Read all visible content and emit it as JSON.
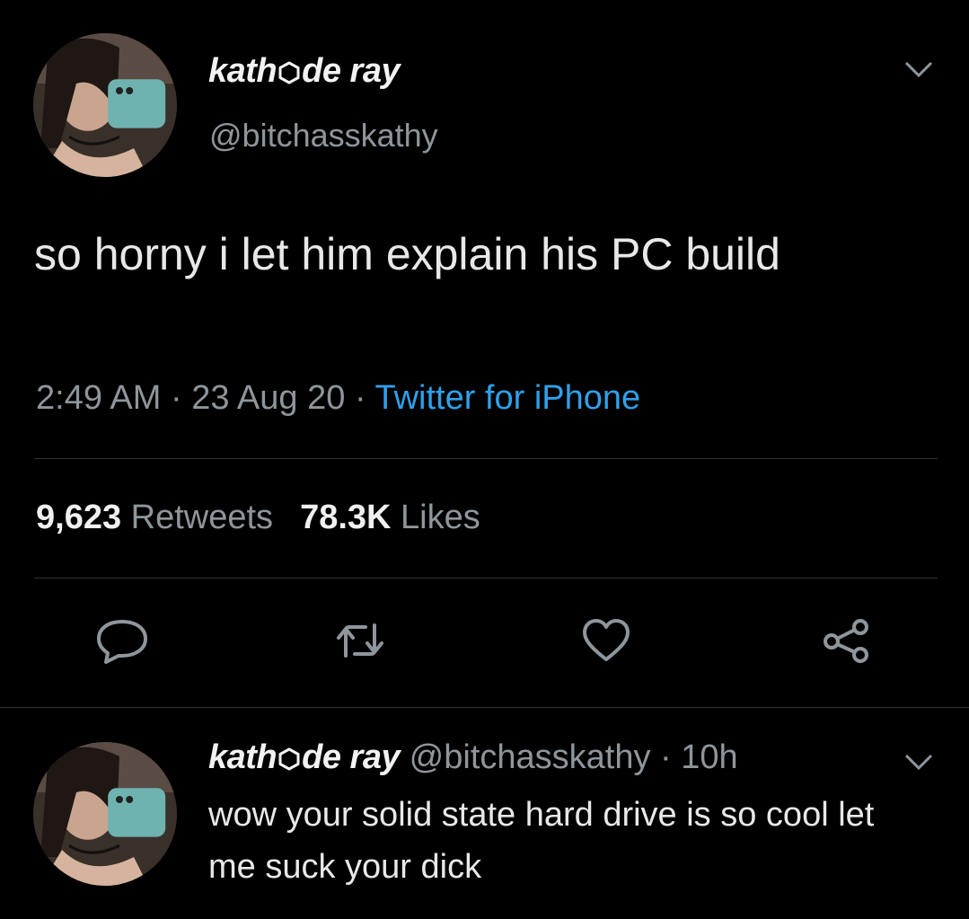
{
  "tweet": {
    "display_name_before": "kath",
    "display_name_after": "de ray",
    "handle": "@bitchasskathy",
    "text": "so horny i let him explain his PC build",
    "time": "2:49 AM",
    "date": "23 Aug 20",
    "source": "Twitter for iPhone",
    "retweet_count": "9,623",
    "retweet_label": "Retweets",
    "like_count": "78.3K",
    "like_label": "Likes"
  },
  "reply": {
    "display_name_before": "kath",
    "display_name_after": "de ray",
    "handle": "@bitchasskathy",
    "age": "10h",
    "text": "wow your solid state hard drive is so cool let me suck your dick"
  },
  "icons": [
    "chevron-down-icon",
    "reply-icon",
    "retweet-icon",
    "like-icon",
    "share-icon",
    "hexagon-emoji-icon"
  ],
  "colors": {
    "background": "#000000",
    "accent": "#2fa0e9",
    "muted": "#8e969c",
    "text": "#e8e8e8"
  }
}
